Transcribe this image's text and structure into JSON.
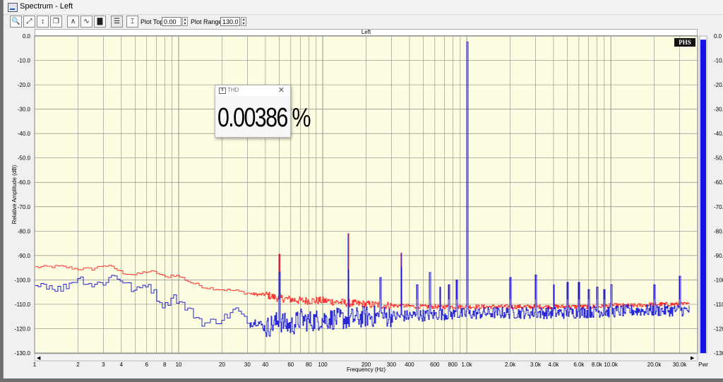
{
  "window": {
    "title": "Spectrum - Left"
  },
  "toolbar": {
    "buttons": [
      "zoom-in-icon",
      "zoom-x-icon",
      "zoom-y-icon",
      "zoom-fit-icon",
      "peak-icon",
      "envelope-icon",
      "bar-graph-icon",
      "data-table-icon",
      "cursor-icon"
    ],
    "plot_top_label": "Plot Top:",
    "plot_top_value": "0.00",
    "plot_range_label": "Plot Range:",
    "plot_range_value": "130.0"
  },
  "graph": {
    "header": "Left",
    "badge": "PHS"
  },
  "thd_popup": {
    "title": "THD",
    "value": "0.00386 %"
  },
  "power_bar": {
    "label": "Pwr",
    "level_db": -1.5
  },
  "colors": {
    "plot_bg": "#fdfde1",
    "grid": "#8a8a8a",
    "series_red": "#ff2020",
    "series_blue": "#1010d8",
    "power": "#1414e6"
  },
  "chart_data": {
    "type": "line",
    "title": "Left",
    "xlabel": "Frequency (Hz)",
    "ylabel": "Relative Amplitude (dB)",
    "xscale": "log",
    "xlim": [
      1,
      40000
    ],
    "ylim": [
      -130,
      0
    ],
    "x_ticks": [
      1,
      2,
      3,
      4,
      6,
      8,
      10,
      20,
      30,
      40,
      60,
      80,
      100,
      200,
      300,
      400,
      600,
      800,
      1000,
      2000,
      3000,
      4000,
      6000,
      8000,
      10000,
      20000,
      30000
    ],
    "x_tick_labels": [
      "1",
      "2",
      "3",
      "4",
      "6",
      "8",
      "10",
      "20",
      "30",
      "40",
      "60",
      "80",
      "100",
      "200",
      "300",
      "400",
      "600",
      "800",
      "1.0k",
      "2.0k",
      "3.0k",
      "4.0k",
      "6.0k",
      "8.0k",
      "10.0k",
      "20.0k",
      "30.0k"
    ],
    "y_ticks": [
      0,
      -10,
      -20,
      -30,
      -40,
      -50,
      -60,
      -70,
      -80,
      -90,
      -100,
      -110,
      -120,
      -130
    ],
    "y_tick_labels": [
      "0.0",
      "-10.0",
      "-20.0",
      "-30.0",
      "-40.0",
      "-50.0",
      "-60.0",
      "-70.0",
      "-80.0",
      "-90.0",
      "-100.0",
      "-110.0",
      "-120.0",
      "-130.0"
    ],
    "series": [
      {
        "color": "#ff2020",
        "x": [
          1,
          1.5,
          2,
          2.5,
          3,
          3.5,
          4,
          5,
          6,
          7,
          8,
          9,
          10,
          12,
          15,
          20,
          25,
          30,
          35,
          40,
          45,
          50,
          60,
          70,
          80,
          100,
          150,
          200,
          300,
          500,
          700,
          1000,
          1500,
          2000,
          3000,
          5000,
          8000,
          10000,
          15000,
          20000,
          30000,
          35000
        ],
        "y": [
          -94.8,
          -94.5,
          -95.5,
          -95.5,
          -94,
          -95,
          -97,
          -98,
          -96.5,
          -97,
          -99,
          -98,
          -98.5,
          -101,
          -103,
          -104,
          -104.5,
          -105.5,
          -106,
          -106,
          -107,
          -107.5,
          -108,
          -108.5,
          -108.5,
          -108.5,
          -109.5,
          -110,
          -110.5,
          -111,
          -111,
          -111,
          -111,
          -111,
          -111,
          -111,
          -111,
          -110.5,
          -110.5,
          -110,
          -110,
          -110
        ]
      },
      {
        "color": "#1010d8",
        "x": [
          1,
          1.5,
          2,
          2.5,
          3,
          3.5,
          4,
          5,
          6,
          7,
          8,
          9,
          10,
          12,
          15,
          20,
          25,
          30,
          35,
          40,
          45,
          50,
          60,
          70,
          80,
          100,
          150,
          200,
          300,
          500,
          700,
          1000,
          1500,
          2000,
          3000,
          5000,
          8000,
          10000,
          15000,
          20000,
          30000,
          35000
        ],
        "y": [
          -100.5,
          -104,
          -99,
          -102,
          -101,
          -98,
          -100,
          -105,
          -101,
          -107,
          -111,
          -106,
          -109,
          -113,
          -118,
          -116,
          -112,
          -118,
          -117,
          -120,
          -118,
          -117,
          -119,
          -116,
          -117,
          -116,
          -116,
          -115,
          -115,
          -114.5,
          -114,
          -114,
          -113.5,
          -113.5,
          -113.5,
          -113.5,
          -113,
          -113,
          -112.5,
          -112.5,
          -112.5,
          -112.5
        ]
      }
    ],
    "peaks": [
      {
        "x": 50,
        "y": -89.5
      },
      {
        "x": 150,
        "y": -81
      },
      {
        "x": 250,
        "y": -99
      },
      {
        "x": 350,
        "y": -89
      },
      {
        "x": 450,
        "y": -102
      },
      {
        "x": 550,
        "y": -97
      },
      {
        "x": 650,
        "y": -103
      },
      {
        "x": 750,
        "y": -102
      },
      {
        "x": 850,
        "y": -100
      },
      {
        "x": 1000,
        "y": -2.5
      },
      {
        "x": 2000,
        "y": -99
      },
      {
        "x": 3000,
        "y": -98
      },
      {
        "x": 4000,
        "y": -102
      },
      {
        "x": 5000,
        "y": -101
      },
      {
        "x": 6000,
        "y": -101
      },
      {
        "x": 7000,
        "y": -104
      },
      {
        "x": 8000,
        "y": -103
      },
      {
        "x": 9000,
        "y": -104
      },
      {
        "x": 10000,
        "y": -102
      },
      {
        "x": 20000,
        "y": -102
      },
      {
        "x": 30000,
        "y": -98.5
      }
    ]
  }
}
